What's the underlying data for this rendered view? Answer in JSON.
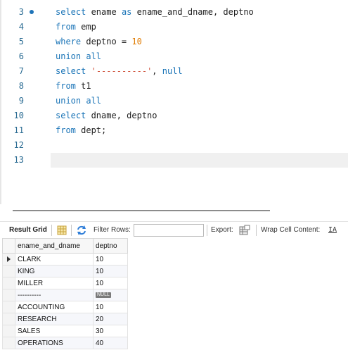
{
  "editor": {
    "lines": [
      {
        "num": "3",
        "tokens": [
          {
            "t": "select",
            "c": "kw"
          },
          {
            "t": " ename ",
            "c": ""
          },
          {
            "t": "as",
            "c": "kw"
          },
          {
            "t": " ename_and_dname, deptno",
            "c": ""
          }
        ]
      },
      {
        "num": "4",
        "tokens": [
          {
            "t": "from",
            "c": "kw"
          },
          {
            "t": " emp",
            "c": ""
          }
        ]
      },
      {
        "num": "5",
        "tokens": [
          {
            "t": "where",
            "c": "kw"
          },
          {
            "t": " deptno = ",
            "c": ""
          },
          {
            "t": "10",
            "c": "num"
          }
        ]
      },
      {
        "num": "6",
        "tokens": [
          {
            "t": "union all",
            "c": "kw"
          }
        ]
      },
      {
        "num": "7",
        "tokens": [
          {
            "t": "select",
            "c": "kw"
          },
          {
            "t": " ",
            "c": ""
          },
          {
            "t": "'----------'",
            "c": "str"
          },
          {
            "t": ", ",
            "c": ""
          },
          {
            "t": "null",
            "c": "kw"
          }
        ]
      },
      {
        "num": "8",
        "tokens": [
          {
            "t": "from",
            "c": "kw"
          },
          {
            "t": " t1",
            "c": ""
          }
        ]
      },
      {
        "num": "9",
        "tokens": [
          {
            "t": "union all",
            "c": "kw"
          }
        ]
      },
      {
        "num": "10",
        "tokens": [
          {
            "t": "select",
            "c": "kw"
          },
          {
            "t": " dname, deptno",
            "c": ""
          }
        ]
      },
      {
        "num": "11",
        "tokens": [
          {
            "t": "from",
            "c": "kw"
          },
          {
            "t": " dept;",
            "c": ""
          }
        ]
      },
      {
        "num": "12",
        "tokens": []
      },
      {
        "num": "13",
        "tokens": []
      }
    ],
    "colors": {
      "keyword": "#1a74b7",
      "number": "#e07b00",
      "string": "#d0553f",
      "line_number": "#2b6c93"
    }
  },
  "toolbar": {
    "result_grid_label": "Result Grid",
    "filter_rows_label": "Filter Rows:",
    "filter_value": "",
    "export_label": "Export:",
    "wrap_label": "Wrap Cell Content:",
    "wrap_icon_text": "IA"
  },
  "grid": {
    "headers": [
      "ename_and_dname",
      "deptno"
    ],
    "rows": [
      [
        "CLARK",
        "10"
      ],
      [
        "KING",
        "10"
      ],
      [
        "MILLER",
        "10"
      ],
      [
        "----------",
        "NULL"
      ],
      [
        "ACCOUNTING",
        "10"
      ],
      [
        "RESEARCH",
        "20"
      ],
      [
        "SALES",
        "30"
      ],
      [
        "OPERATIONS",
        "40"
      ]
    ],
    "null_label": "NULL"
  }
}
